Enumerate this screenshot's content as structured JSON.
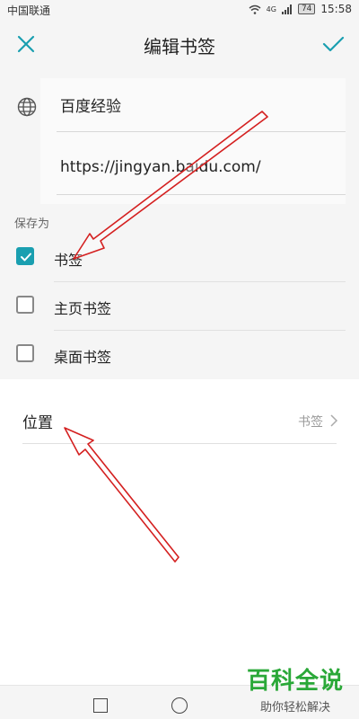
{
  "status_bar": {
    "carrier": "中国联通",
    "network": "4G",
    "battery": "74",
    "time": "15:58"
  },
  "header": {
    "title": "编辑书签"
  },
  "form": {
    "title_value": "百度经验",
    "url_value": "https://jingyan.baidu.com/"
  },
  "save_as": {
    "label": "保存为",
    "options": [
      {
        "label": "书签",
        "checked": true
      },
      {
        "label": "主页书签",
        "checked": false
      },
      {
        "label": "桌面书签",
        "checked": false
      }
    ]
  },
  "location": {
    "label": "位置",
    "value": "书签"
  },
  "watermark": {
    "main": "百科全说",
    "sub": "助你轻松解决"
  },
  "colors": {
    "accent": "#1a9fb0",
    "annotation_arrow": "#d42020"
  }
}
